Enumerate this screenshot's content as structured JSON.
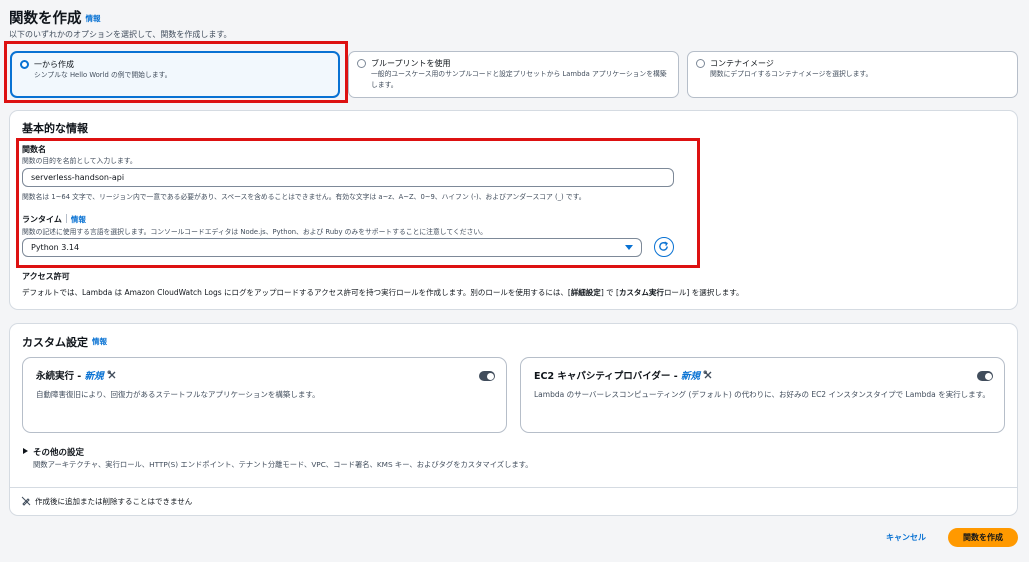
{
  "header": {
    "title": "関数を作成",
    "info": "情報",
    "subtitle": "以下のいずれかのオプションを選択して、関数を作成します。"
  },
  "options": [
    {
      "title": "一から作成",
      "desc": "シンプルな Hello World の例で開始します。",
      "selected": true
    },
    {
      "title": "ブループリントを使用",
      "desc": "一般的ユースケース用のサンプルコードと設定プリセットから Lambda アプリケーションを構築します。",
      "selected": false
    },
    {
      "title": "コンテナイメージ",
      "desc": "関数にデプロイするコンテナイメージを選択します。",
      "selected": false
    }
  ],
  "basic": {
    "title": "基本的な情報",
    "function_name": {
      "label": "関数名",
      "desc": "関数の目的を名前として入力します。",
      "value": "serverless-handson-api",
      "constraint": "関数名は 1~64 文字で、リージョン内で一意である必要があり、スペースを含めることはできません。有効な文字は a~z、A~Z、0~9、ハイフン (-)、およびアンダースコア (_) です。"
    },
    "runtime": {
      "label": "ランタイム",
      "info": "情報",
      "desc": "関数の記述に使用する言語を選択します。コンソールコードエディタは Node.js、Python、および Ruby のみをサポートすることに注意してください。",
      "value": "Python 3.14"
    },
    "permissions": {
      "label": "アクセス許可",
      "desc_pre": "デフォルトでは、Lambda は Amazon CloudWatch Logs にログをアップロードするアクセス許可を持つ実行ロールを作成します。別のロールを使用するには、[",
      "desc_bold1": "詳細設定",
      "desc_mid": "] で [",
      "desc_bold2": "カスタム実行",
      "desc_post": "ロール] を選択します。"
    }
  },
  "custom": {
    "title": "カスタム設定",
    "info": "情報",
    "durable": {
      "title": "永続実行 - ",
      "badge": "新規",
      "desc": "自動障害復旧により、回復力があるステートフルなアプリケーションを構築します。"
    },
    "ec2": {
      "title": "EC2 キャパシティプロバイダー - ",
      "badge": "新規",
      "desc": "Lambda のサーバーレスコンピューティング (デフォルト) の代わりに、お好みの EC2 インスタンスタイプで Lambda を実行します。"
    },
    "other": {
      "title": "その他の設定",
      "desc": "関数アーキテクチャ、実行ロール、HTTP(S) エンドポイント、テナント分離モード、VPC、コード署名、KMS キー、およびタグをカスタマイズします。"
    },
    "note": "作成後に追加または削除することはできません"
  },
  "footer": {
    "cancel": "キャンセル",
    "create": "関数を作成"
  },
  "colors": {
    "accent": "#0972d3",
    "primary_button": "#ff9900",
    "highlight_border": "#dd1111"
  }
}
